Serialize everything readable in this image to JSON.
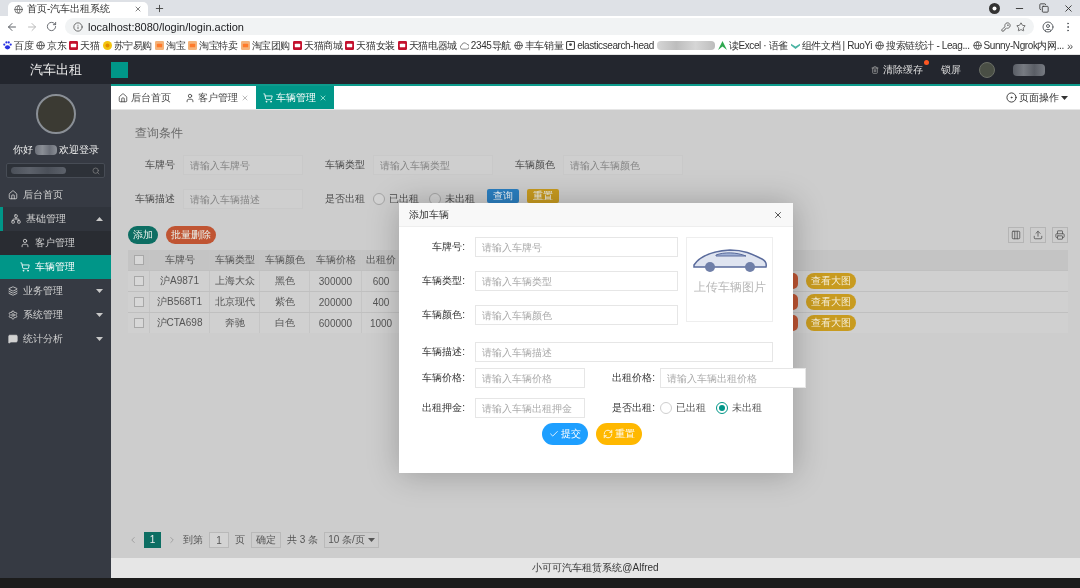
{
  "browser": {
    "tab": {
      "title": "首页-汽车出租系统"
    },
    "url": "localhost:8080/login/login.action",
    "bookmarks": [
      {
        "kind": "link",
        "label": "百度"
      },
      {
        "kind": "link",
        "label": "京东"
      },
      {
        "kind": "link",
        "label": "天猫"
      },
      {
        "kind": "link",
        "label": "苏宁易购"
      },
      {
        "kind": "link",
        "label": "淘宝"
      },
      {
        "kind": "link",
        "label": "淘宝特卖"
      },
      {
        "kind": "link",
        "label": "淘宝团购"
      },
      {
        "kind": "link",
        "label": "天猫商城"
      },
      {
        "kind": "link",
        "label": "天猫女装"
      },
      {
        "kind": "link",
        "label": "天猫电器城"
      },
      {
        "kind": "link",
        "label": "2345导航"
      },
      {
        "kind": "link",
        "label": "丰车销量"
      },
      {
        "kind": "link",
        "label": "elasticsearch-head"
      },
      {
        "kind": "blurred"
      },
      {
        "kind": "link",
        "label": "读Excel · 语雀"
      },
      {
        "kind": "link",
        "label": "组件文档 | RuoYi"
      },
      {
        "kind": "link",
        "label": "搜索链统计 - Leag..."
      },
      {
        "kind": "link",
        "label": "Sunny-Ngrok内网..."
      }
    ],
    "more": "»"
  },
  "header": {
    "logo": "汽车出租",
    "actions": [
      {
        "label": "清除缓存",
        "badge": true
      },
      {
        "label": "锁屏",
        "badge": false
      }
    ]
  },
  "sidebar": {
    "greeting": "你好",
    "welcome": "欢迎登录",
    "items": [
      {
        "kind": "link",
        "label": "后台首页",
        "selected": false
      },
      {
        "kind": "group",
        "label": "基础管理",
        "selected": false,
        "expanded": true,
        "children": [
          {
            "label": "客户管理",
            "selected": false
          },
          {
            "label": "车辆管理",
            "selected": true
          }
        ]
      },
      {
        "kind": "group",
        "label": "业务管理",
        "selected": false,
        "expanded": false
      },
      {
        "kind": "group",
        "label": "系统管理",
        "selected": false,
        "expanded": false
      },
      {
        "kind": "group",
        "label": "统计分析",
        "selected": false,
        "expanded": false
      }
    ]
  },
  "tabs": [
    {
      "label": "后台首页",
      "closable": false,
      "selected": false
    },
    {
      "label": "客户管理",
      "closable": true,
      "selected": false
    },
    {
      "label": "车辆管理",
      "closable": true,
      "selected": true
    }
  ],
  "page_actions": {
    "label": "页面操作"
  },
  "query": {
    "title": "查询条件",
    "rows": [
      [
        {
          "kind": "input",
          "label": "车牌号",
          "placeholder": "请输入车牌号"
        },
        {
          "kind": "input",
          "label": "车辆类型",
          "placeholder": "请输入车辆类型"
        },
        {
          "kind": "input",
          "label": "车辆颜色",
          "placeholder": "请输入车辆颜色"
        }
      ],
      [
        {
          "kind": "input",
          "label": "车辆描述",
          "placeholder": "请输入车辆描述"
        },
        {
          "kind": "radio",
          "label": "是否出租",
          "options": [
            {
              "label": "已出租",
              "selected": false
            },
            {
              "label": "未出租",
              "selected": false
            }
          ]
        }
      ]
    ],
    "buttons": [
      {
        "kind": "primary",
        "label": "查询"
      },
      {
        "kind": "warning",
        "label": "重置"
      }
    ]
  },
  "toolbar": {
    "buttons": [
      {
        "kind": "add",
        "label": "添加"
      },
      {
        "kind": "danger",
        "label": "批量删除"
      }
    ]
  },
  "table": {
    "all_checked": false,
    "columns": [
      "车牌号",
      "车辆类型",
      "车辆颜色",
      "车辆价格",
      "出租价"
    ],
    "rows": [
      {
        "checked": false,
        "cells": [
          "沪A9871",
          "上海大众",
          "黑色",
          "300000",
          "600"
        ],
        "actions": [
          {
            "kind": "danger"
          },
          {
            "kind": "warning",
            "label": "查看大图"
          }
        ]
      },
      {
        "checked": false,
        "cells": [
          "沪B568T1",
          "北京现代",
          "紫色",
          "200000",
          "400"
        ],
        "actions": [
          {
            "kind": "danger"
          },
          {
            "kind": "warning",
            "label": "查看大图"
          }
        ]
      },
      {
        "checked": false,
        "cells": [
          "沪CTA698",
          "奔驰",
          "白色",
          "600000",
          "1000"
        ],
        "actions": [
          {
            "kind": "danger"
          },
          {
            "kind": "warning",
            "label": "查看大图"
          }
        ]
      }
    ]
  },
  "pagination": {
    "pages": [
      {
        "label": "1",
        "selected": true
      }
    ],
    "goto_label": "到第",
    "goto_value": "1",
    "goto_unit": "页",
    "confirm": "确定",
    "total": "共 3 条",
    "page_size": "10 条/页"
  },
  "footer": "小可可汽车租赁系统@Alfred",
  "dialog": {
    "title": "添加车辆",
    "top_fields": [
      {
        "kind": "input",
        "label": "车牌号:",
        "placeholder": "请输入车牌号"
      },
      {
        "kind": "input",
        "label": "车辆类型:",
        "placeholder": "请输入车辆类型"
      },
      {
        "kind": "input",
        "label": "车辆颜色:",
        "placeholder": "请输入车辆颜色"
      }
    ],
    "upload": {
      "label": "上传车辆图片"
    },
    "wide_fields": [
      {
        "kind": "input",
        "label": "车辆描述:",
        "placeholder": "请输入车辆描述"
      }
    ],
    "pair_rows": [
      [
        {
          "kind": "input",
          "label": "车辆价格:",
          "placeholder": "请输入车辆价格"
        },
        {
          "kind": "input",
          "label": "出租价格:",
          "placeholder": "请输入车辆出租价格"
        }
      ],
      [
        {
          "kind": "input",
          "label": "出租押金:",
          "placeholder": "请输入车辆出租押金"
        },
        {
          "kind": "radio",
          "label": "是否出租:",
          "options": [
            {
              "label": "已出租",
              "selected": false
            },
            {
              "label": "未出租",
              "selected": true
            }
          ]
        }
      ]
    ],
    "buttons": [
      {
        "kind": "primary",
        "label": "提交"
      },
      {
        "kind": "warning",
        "label": "重置"
      }
    ]
  }
}
